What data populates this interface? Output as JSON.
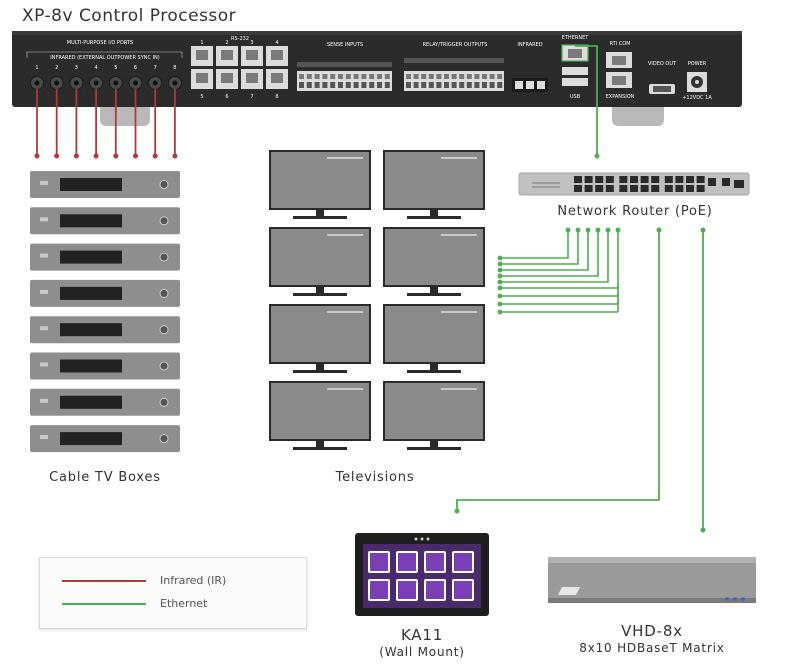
{
  "title": "XP-8v Control Processor",
  "colors": {
    "infrared": "#b03a3a",
    "ethernet": "#4caf50",
    "panel": "#2b2b2b",
    "device": "#8e8e8e",
    "touch_ui": "#7b3fb5"
  },
  "processor": {
    "port_groups": {
      "multipurpose": "MULTI-PURPOSE I/O PORTS",
      "multipurpose_sub": "INFRARED (EXTERNAL OUTPOWER SYNC IN)",
      "rs232": "RS-232",
      "sense": "SENSE INPUTS",
      "relay": "RELAY/TRIGGER OUTPUTS",
      "infrared": "INFRARED",
      "ethernet": "ETHERNET",
      "rti_com": "RTI COM",
      "usb": "USB",
      "expansion": "EXPANSION",
      "video_out": "VIDEO OUT",
      "power": "POWER",
      "power_spec": "+12VDC 1A"
    },
    "mp_port_numbers": [
      "1",
      "2",
      "3",
      "4",
      "5",
      "6",
      "7",
      "8"
    ],
    "rs232_numbers_top": [
      "1",
      "2",
      "3",
      "4"
    ],
    "rs232_numbers_bottom": [
      "5",
      "6",
      "7",
      "8"
    ]
  },
  "router": {
    "label": "Network Router (PoE)"
  },
  "groups": {
    "cable_boxes": "Cable TV Boxes",
    "televisions": "Televisions"
  },
  "devices": {
    "ka11": {
      "name": "KA11",
      "sub": "(Wall Mount)"
    },
    "vhd": {
      "name": "VHD-8x",
      "sub": "8x10 HDBaseT Matrix"
    }
  },
  "legend": [
    {
      "label": "Infrared (IR)",
      "color": "#b03a3a"
    },
    {
      "label": "Ethernet",
      "color": "#4caf50"
    }
  ]
}
